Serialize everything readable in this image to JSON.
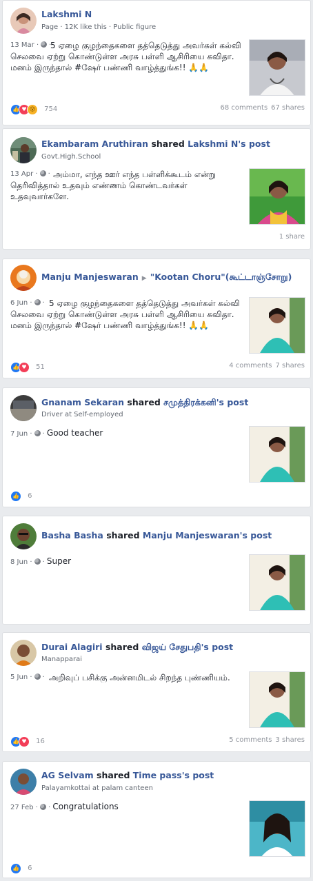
{
  "colors": {
    "link": "#385898",
    "like": "#2078f4",
    "love": "#f33e58",
    "wow": "#f7b125",
    "meta": "#616770"
  },
  "posts": [
    {
      "author": "Lakshmi N",
      "shared": "",
      "target": "",
      "arrow_target": "",
      "sub": "Page · 12K like this · Public figure",
      "date": "13 Mar",
      "text": "5 ஏழை குழந்தைகளை தத்தெடுத்து அவர்கள் கல்வி செலவை ஏற்று கொண்டுள்ள அரசு பள்ளி ஆசிரியை கவிதா. மனம் இருந்தால் #ஷேர் பண்ணி வாழ்த்துங்க!! 🙏🙏",
      "reactions": [
        "like-icon",
        "love-icon",
        "wow-icon"
      ],
      "count": "754",
      "comments": "68 comments",
      "shares": "67 shares"
    },
    {
      "author": "Ekambaram Aruthiran",
      "shared": "shared",
      "target": "Lakshmi N's post",
      "arrow_target": "",
      "sub": "Govt.High.School",
      "date": "13 Apr",
      "text": "அம்மா, எந்த ஊர் எந்த பள்ளிக்கூடம் என்று தெரிவித்தால் உதவும் எண்ணம் கொண்டவர்கள் உதவுவார்களே.",
      "reactions": [],
      "count": "",
      "comments": "",
      "shares": "1 share"
    },
    {
      "author": "Manju Manjeswaran",
      "shared": "",
      "target": "",
      "arrow_target": "\"Kootan Choru\"(கூட்டாஞ்சோறு)",
      "sub": "",
      "date": "6 Jun",
      "text": "5 ஏழை குழந்தைகளை தத்தெடுத்து அவர்கள் கல்வி செலவை ஏற்று கொண்டுள்ள அரசு பள்ளி ஆசிரியை கவிதா. மனம் இருந்தால் #ஷேர் பண்ணி வாழ்த்துங்க!! 🙏🙏",
      "reactions": [
        "like-icon",
        "love-icon"
      ],
      "count": "51",
      "comments": "4 comments",
      "shares": "7 shares"
    },
    {
      "author": "Gnanam Sekaran",
      "shared": "shared",
      "target": "சமுத்திரக்கனி's post",
      "arrow_target": "",
      "sub": "Driver at Self-employed",
      "date": "7 Jun",
      "text": "Good teacher",
      "reactions": [
        "like-icon"
      ],
      "count": "6",
      "comments": "",
      "shares": ""
    },
    {
      "author": "Basha Basha",
      "shared": "shared",
      "target": "Manju Manjeswaran's post",
      "arrow_target": "",
      "sub": "",
      "date": "8 Jun",
      "text": "Super",
      "reactions": [],
      "count": "",
      "comments": "",
      "shares": ""
    },
    {
      "author": "Durai Alagiri",
      "shared": "shared",
      "target": "விஜய் சேதுபதி's post",
      "arrow_target": "",
      "sub": "Manapparai",
      "date": "5 Jun",
      "text": "அறிவுப் பசிக்கு அன்னமிடல் சிறந்த புண்ணியம்.",
      "reactions": [
        "like-icon",
        "love-icon"
      ],
      "count": "16",
      "comments": "5 comments",
      "shares": "3 shares"
    },
    {
      "author": "AG Selvam",
      "shared": "shared",
      "target": "Time pass's post",
      "arrow_target": "",
      "sub": "Palayamkottai at palam canteen",
      "date": "27 Feb",
      "text": "Congratulations",
      "reactions": [
        "like-icon"
      ],
      "count": "6",
      "comments": "",
      "shares": ""
    }
  ]
}
